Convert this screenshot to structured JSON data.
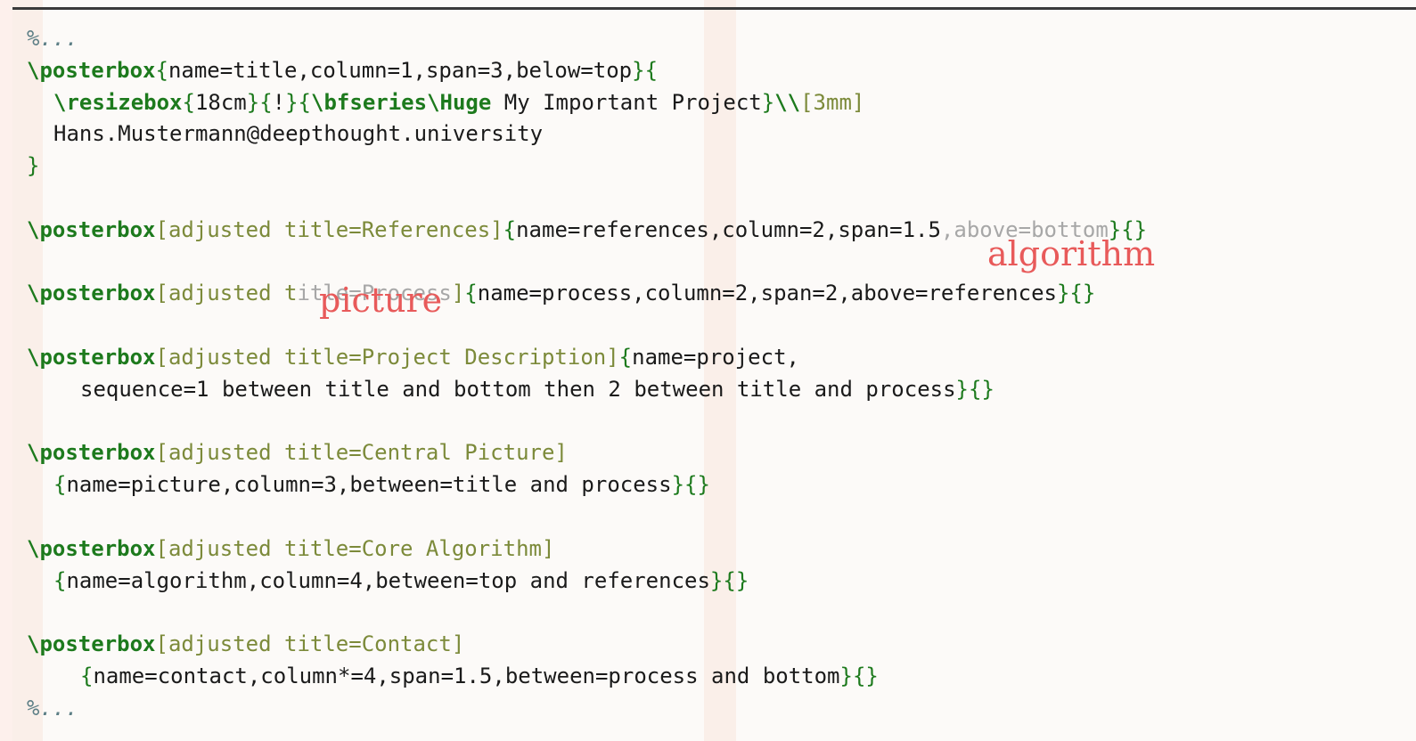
{
  "code": {
    "comment_start": "%...",
    "comment_end": "%...",
    "title_box": {
      "cmd": "\\posterbox",
      "open": "{",
      "args": "name=title,column=1,span=3,below=top",
      "close_open": "}{",
      "resize_cmd": "\\resizebox",
      "resize_w_open": "{",
      "resize_w": "18cm",
      "resize_sep1": "}{",
      "resize_h": "!",
      "resize_sep2": "}{",
      "bf_cmd": "\\bfseries",
      "huge_cmd": "\\Huge",
      "title_text": " My Important Project",
      "resize_close": "}",
      "newline_cmd": "\\\\",
      "newline_opt": "[3mm]",
      "email": "Hans.Mustermann@deepthought.university",
      "end_brace": "}"
    },
    "references_box": {
      "cmd": "\\posterbox",
      "opt": "[adjusted title=References]",
      "open": "{",
      "args": "name=references,column=2,span=1.5",
      "args_faded": ",above=bottom",
      "close": "}{}"
    },
    "process_box": {
      "cmd": "\\posterbox",
      "opt_before": "[adjusted t",
      "opt_faded": "itle=Process",
      "opt_after": "]",
      "open": "{",
      "args": "name=process,column=2,span=2,above=references",
      "close": "}{}"
    },
    "project_box": {
      "cmd": "\\posterbox",
      "opt": "[adjusted title=Project Description]",
      "open": "{",
      "args_line1": "name=project,",
      "args_line2": "sequence=1 between title and bottom then 2 between title and process",
      "close": "}{}"
    },
    "picture_box": {
      "cmd": "\\posterbox",
      "opt": "[adjusted title=Central Picture]",
      "open": "{",
      "args": "name=picture,column=3,between=title and process",
      "close": "}{}"
    },
    "algorithm_box": {
      "cmd": "\\posterbox",
      "opt": "[adjusted title=Core Algorithm]",
      "open": "{",
      "args": "name=algorithm,column=4,between=top and references",
      "close": "}{}"
    },
    "contact_box": {
      "cmd": "\\posterbox",
      "opt": "[adjusted title=Contact]",
      "open": "{",
      "args": "name=contact,column*=4,span=1.5,between=process and bottom",
      "close": "}{}"
    }
  },
  "overlays": {
    "algorithm": "algorithm",
    "picture": "picture"
  },
  "colors": {
    "keyword": "#1d7a1d",
    "option": "#7c8a3a",
    "comment": "#5d7f86",
    "overlay_label": "#e85a5a",
    "background": "#fcfaf8"
  }
}
